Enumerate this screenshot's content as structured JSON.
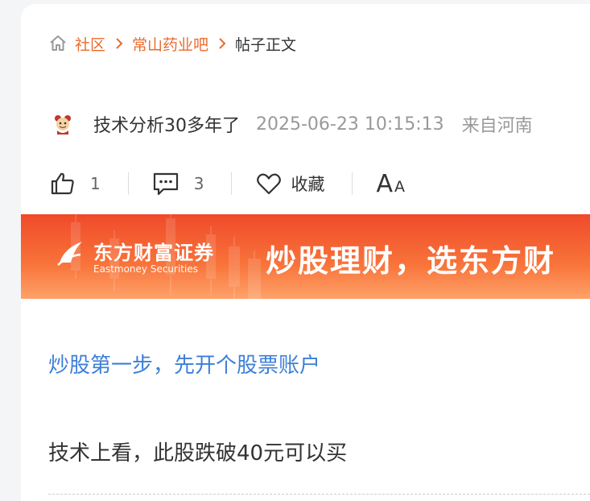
{
  "breadcrumb": {
    "home_icon": "home-icon",
    "items": [
      "社区",
      "常山药业吧"
    ],
    "current": "帖子正文",
    "link_color": "#ea6b2e"
  },
  "author": {
    "avatar_icon": "avatar-icon",
    "name": "技术分析30多年了",
    "time": "2025-06-23 10:15:13",
    "location": "来自河南"
  },
  "actions": {
    "like_icon": "thumbs-up-icon",
    "like_count": "1",
    "comment_icon": "comment-icon",
    "comment_count": "3",
    "favorite_icon": "heart-icon",
    "favorite_label": "收藏",
    "font_big": "A",
    "font_small": "A"
  },
  "banner": {
    "brand_cn": "东方财富证券",
    "brand_en": "Eastmoney Securities",
    "slogan": "炒股理财，选东方财",
    "colors": {
      "top": "#f04a2a",
      "bottom": "#ffa26a"
    }
  },
  "body": {
    "promo_link": "炒股第一步，先开个股票账户",
    "promo_color": "#3d7fd8",
    "content": "技术上看，此股跌破40元可以买"
  }
}
